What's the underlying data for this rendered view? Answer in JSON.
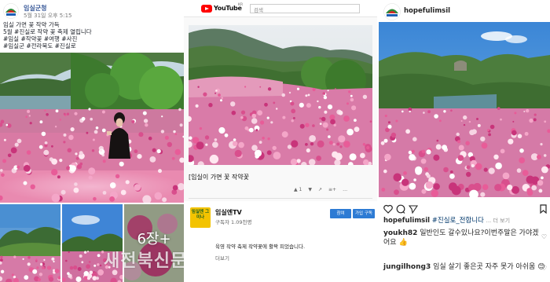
{
  "facebook": {
    "page_name": "임실군청",
    "meta": "5월 31일 오후 5:15",
    "post_lines": [
      "임실 가면 꽃 작약 가득",
      "5월 #진실로 작약 꽃 축제 열립니다",
      "#임실 #작약꽃 #여행 #사진",
      "#임실군 #전라북도 #진실로"
    ],
    "more_photos_label": "6장+",
    "watermark": "새전북신문"
  },
  "youtube": {
    "logo_text": "YouTube",
    "country": "KR",
    "search_placeholder": "검색",
    "video_title": "[임실이 가면 꽃 작약꽃",
    "stats": [
      "▲ 1",
      "▼",
      "↗",
      "≡+",
      "…"
    ],
    "channel_name": "임실엔TV",
    "subscribers": "구독자 1.09천명",
    "avatar_text": "임실엔\n그미나",
    "subscribe_label": "참여",
    "join_label": "가입 구독",
    "description": "육영 작약 축제 작약꽃에 활짝 피었습니다.",
    "more_label": "더보기"
  },
  "instagram": {
    "handle": "hopefulimsil",
    "caption_user": "hopefulimsil",
    "caption_tag": "#진실로_전합니다",
    "caption_more": "... 더 보기",
    "comment1_user": "youkh82",
    "comment1_text": "일반인도 갈수있나요?이번주말은 가야겠어요",
    "comment2_user": "jungilhong3",
    "comment2_text": "임실 살기 좋은곳 자주 못가 아쉬움"
  },
  "colors": {
    "fb_link": "#385898",
    "yt_red": "#ff0000",
    "yt_button": "#2d7bd4",
    "ig_tag": "#00376b"
  }
}
